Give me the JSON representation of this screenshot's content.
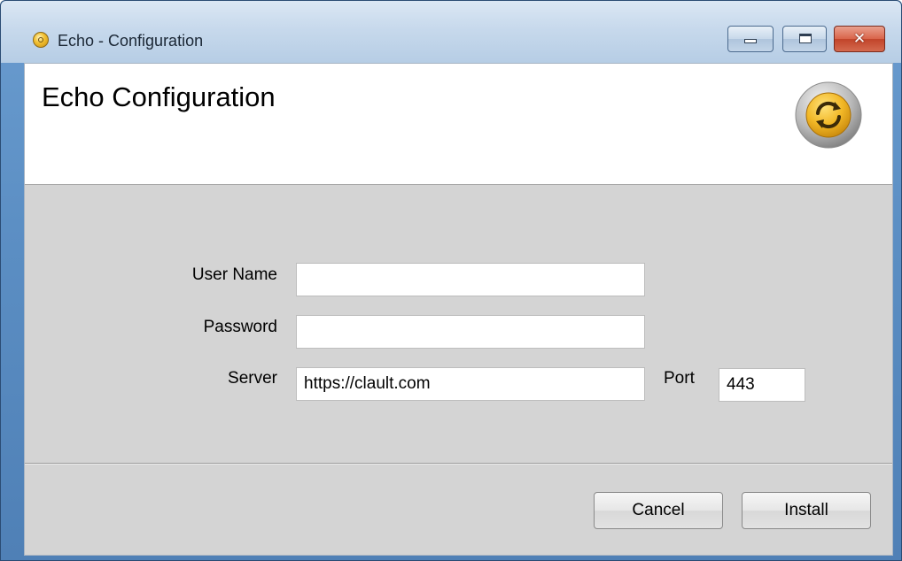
{
  "window": {
    "title": "Echo - Configuration",
    "app_icon": "echo-app-icon",
    "close_glyph": "✕"
  },
  "header": {
    "title": "Echo Configuration",
    "logo": "echo-sync-logo-icon"
  },
  "form": {
    "user_name_label": "User Name",
    "user_name_value": "",
    "password_label": "Password",
    "password_value": "",
    "server_label": "Server",
    "server_value": "https://clault.com",
    "port_label": "Port",
    "port_value": "443"
  },
  "buttons": {
    "cancel_label": "Cancel",
    "install_label": "Install"
  },
  "colors": {
    "accent_gold": "#f2b827",
    "window_frame_blue": "#5c8fc4",
    "close_button_red": "#c1442a",
    "dialog_gray": "#d4d4d4"
  }
}
